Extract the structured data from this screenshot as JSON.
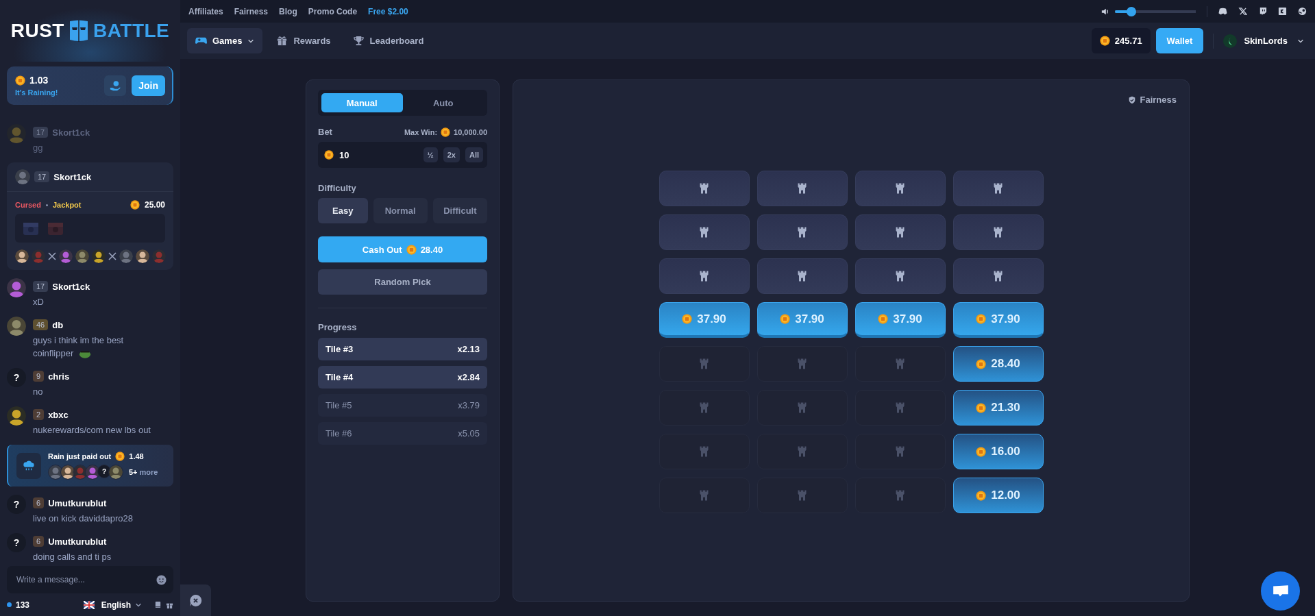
{
  "logo": {
    "left": "RUST",
    "right": "BATTLE"
  },
  "rain_banner": {
    "amount": "1.03",
    "label": "It's Raining!",
    "join": "Join"
  },
  "chat": [
    {
      "kind": "message",
      "faded": true,
      "avatar": {
        "kind": "picture"
      },
      "level": "17",
      "color": "#363d52",
      "name": "Skort1ck",
      "text": "gg"
    },
    {
      "kind": "game",
      "faded": false,
      "avatar": {
        "kind": "picture"
      },
      "level": "17",
      "color": "#363d52",
      "name": "Skort1ck",
      "mode": "Cursed",
      "game": "Jackpot",
      "amount": "25.00"
    },
    {
      "kind": "message",
      "faded": false,
      "avatar": {
        "kind": "picture"
      },
      "level": "17",
      "color": "#363d52",
      "name": "Skort1ck",
      "text": "xD"
    },
    {
      "kind": "message",
      "faded": false,
      "avatar": {
        "kind": "picture"
      },
      "level": "46",
      "color": "#5e5030",
      "name": "db",
      "text": "guys i think im the best coinflipper",
      "emoji": true
    },
    {
      "kind": "message",
      "faded": false,
      "avatar": {
        "kind": "text",
        "text": "?"
      },
      "level": "9",
      "color": "#4e3d35",
      "name": "chris",
      "text": "no"
    },
    {
      "kind": "message",
      "faded": false,
      "avatar": {
        "kind": "picture"
      },
      "level": "2",
      "color": "#4e3d35",
      "name": "xbxc",
      "text": "nukerewards/com new lbs out"
    },
    {
      "kind": "rain",
      "title": "Rain just paid out",
      "amount": "1.48",
      "avatars": [
        {
          "kind": "picture"
        },
        {
          "kind": "picture"
        },
        {
          "kind": "picture"
        },
        {
          "kind": "picture"
        },
        {
          "kind": "text",
          "text": "?"
        },
        {
          "kind": "picture"
        }
      ],
      "more_count": "5+",
      "more_label": "more"
    },
    {
      "kind": "message",
      "faded": false,
      "avatar": {
        "kind": "text",
        "text": "?"
      },
      "level": "6",
      "color": "#4e3d35",
      "name": "Umutkurublut",
      "text": "live on kick daviddapro28"
    },
    {
      "kind": "message",
      "faded": false,
      "avatar": {
        "kind": "text",
        "text": "?"
      },
      "level": "6",
      "color": "#4e3d35",
      "name": "Umutkurublut",
      "text": "doing calls and ti ps"
    }
  ],
  "chat_input": {
    "placeholder": "Write a message..."
  },
  "footer": {
    "online": "133",
    "language": "English"
  },
  "top_links": [
    {
      "label": "Affiliates",
      "highlight": false
    },
    {
      "label": "Fairness",
      "highlight": false
    },
    {
      "label": "Blog",
      "highlight": false
    },
    {
      "label": "Promo Code",
      "highlight": false
    },
    {
      "label": "Free $2.00",
      "highlight": true
    }
  ],
  "volume": {
    "level": 0.2
  },
  "nav": [
    {
      "label": "Games",
      "selected": true
    },
    {
      "label": "Rewards",
      "selected": false
    },
    {
      "label": "Leaderboard",
      "selected": false
    }
  ],
  "balance": "245.71",
  "wallet": "Wallet",
  "user": "SkinLords",
  "controls": {
    "tabs": [
      {
        "label": "Manual",
        "selected": true
      },
      {
        "label": "Auto",
        "selected": false
      }
    ],
    "bet_label": "Bet",
    "max_win_label": "Max Win:",
    "max_win": "10,000.00",
    "bet_value": "10",
    "bet_buttons": [
      "½",
      "2x",
      "All"
    ],
    "difficulty_label": "Difficulty",
    "difficulties": [
      {
        "label": "Easy",
        "selected": true
      },
      {
        "label": "Normal",
        "selected": false
      },
      {
        "label": "Difficult",
        "selected": false
      }
    ],
    "cash_out": {
      "label": "Cash Out",
      "amount": "28.40"
    },
    "random_pick": "Random Pick",
    "progress_label": "Progress",
    "progress": [
      {
        "tile": "Tile #3",
        "multiplier": "x2.13",
        "reached": true
      },
      {
        "tile": "Tile #4",
        "multiplier": "x2.84",
        "reached": true
      },
      {
        "tile": "Tile #5",
        "multiplier": "x3.79",
        "reached": false
      },
      {
        "tile": "Tile #6",
        "multiplier": "x5.05",
        "reached": false
      }
    ]
  },
  "fairness": "Fairness",
  "grid": [
    [
      {
        "kind": "tower",
        "dimmed": false
      },
      {
        "kind": "tower",
        "dimmed": false
      },
      {
        "kind": "tower",
        "dimmed": false
      },
      {
        "kind": "tower",
        "dimmed": false
      }
    ],
    [
      {
        "kind": "tower",
        "dimmed": false
      },
      {
        "kind": "tower",
        "dimmed": false
      },
      {
        "kind": "tower",
        "dimmed": false
      },
      {
        "kind": "tower",
        "dimmed": false
      }
    ],
    [
      {
        "kind": "tower",
        "dimmed": false
      },
      {
        "kind": "tower",
        "dimmed": false
      },
      {
        "kind": "tower",
        "dimmed": false
      },
      {
        "kind": "tower",
        "dimmed": false
      }
    ],
    [
      {
        "kind": "payout",
        "amount": "37.90",
        "current": true
      },
      {
        "kind": "payout",
        "amount": "37.90",
        "current": true
      },
      {
        "kind": "payout",
        "amount": "37.90",
        "current": true
      },
      {
        "kind": "payout",
        "amount": "37.90",
        "current": true
      }
    ],
    [
      {
        "kind": "tower",
        "dimmed": true
      },
      {
        "kind": "tower",
        "dimmed": true
      },
      {
        "kind": "tower",
        "dimmed": true
      },
      {
        "kind": "payout",
        "amount": "28.40",
        "current": false
      }
    ],
    [
      {
        "kind": "tower",
        "dimmed": true
      },
      {
        "kind": "tower",
        "dimmed": true
      },
      {
        "kind": "tower",
        "dimmed": true
      },
      {
        "kind": "payout",
        "amount": "21.30",
        "current": false
      }
    ],
    [
      {
        "kind": "tower",
        "dimmed": true
      },
      {
        "kind": "tower",
        "dimmed": true
      },
      {
        "kind": "tower",
        "dimmed": true
      },
      {
        "kind": "payout",
        "amount": "16.00",
        "current": false
      }
    ],
    [
      {
        "kind": "tower",
        "dimmed": true
      },
      {
        "kind": "tower",
        "dimmed": true
      },
      {
        "kind": "tower",
        "dimmed": true
      },
      {
        "kind": "payout",
        "amount": "12.00",
        "current": false
      }
    ]
  ]
}
